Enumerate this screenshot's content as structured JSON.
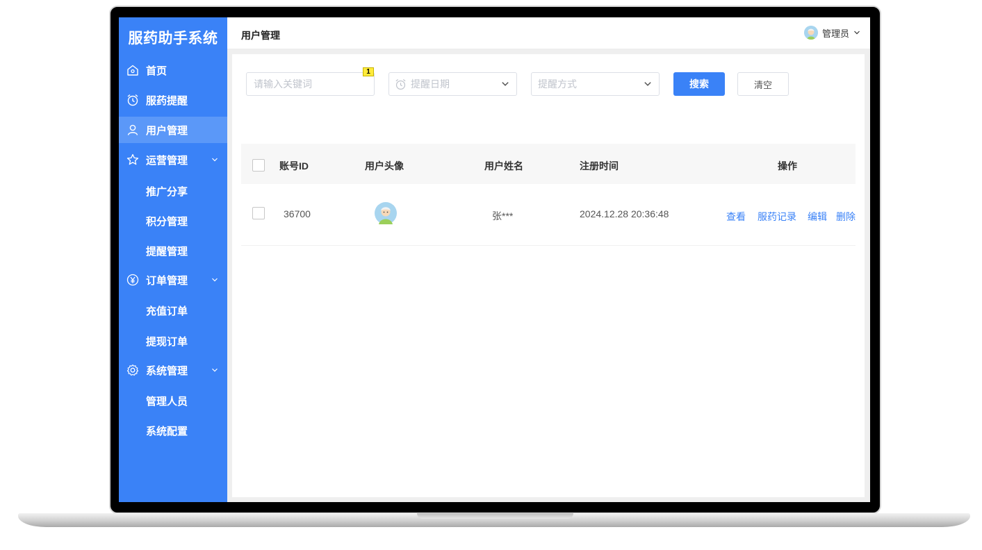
{
  "app": {
    "brand": "服药助手系统"
  },
  "sidebar": {
    "items": [
      {
        "label": "首页",
        "icon": "home-icon"
      },
      {
        "label": "服药提醒",
        "icon": "alarm-clock-icon"
      },
      {
        "label": "用户管理",
        "icon": "user-icon",
        "active": true
      },
      {
        "label": "运营管理",
        "icon": "star-icon",
        "children": [
          "推广分享",
          "积分管理",
          "提醒管理"
        ]
      },
      {
        "label": "订单管理",
        "icon": "yen-icon",
        "children": [
          "充值订单",
          "提现订单"
        ]
      },
      {
        "label": "系统管理",
        "icon": "gear-icon",
        "children": [
          "管理人员",
          "系统配置"
        ]
      }
    ]
  },
  "header": {
    "title": "用户管理",
    "user_name": "管理员"
  },
  "filters": {
    "keyword_placeholder": "请输入关键词",
    "date_placeholder": "提醒日期",
    "method_placeholder": "提醒方式",
    "search_label": "搜索",
    "clear_label": "清空",
    "badge": "1"
  },
  "table": {
    "columns": [
      "账号ID",
      "用户头像",
      "用户姓名",
      "注册时间",
      "操作"
    ],
    "rows": [
      {
        "id": "36700",
        "name": "张***",
        "registered": "2024.12.28 20:36:48",
        "actions": [
          "查看",
          "服药记录",
          "编辑",
          "删除"
        ]
      }
    ]
  },
  "colors": {
    "accent": "#3a82f7",
    "sidebar_active": "#5b98f8"
  }
}
